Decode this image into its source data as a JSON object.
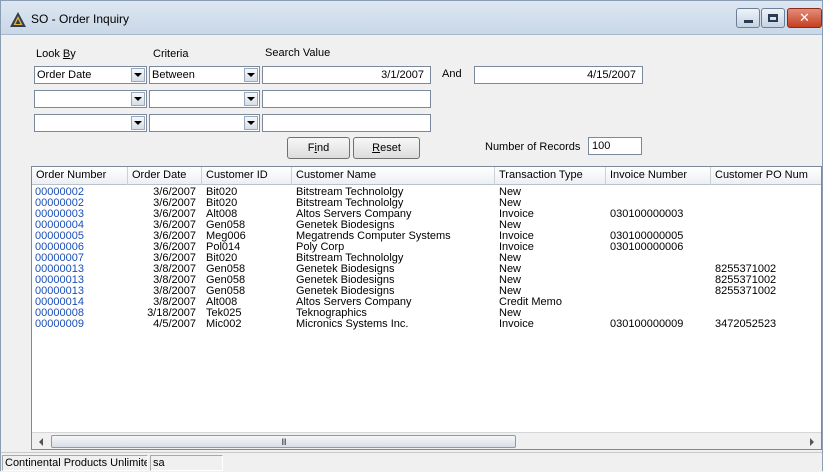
{
  "window": {
    "title": "SO - Order Inquiry"
  },
  "labels": {
    "look_by_prefix": "Look ",
    "look_by_underlined": "B",
    "look_by_suffix": "y",
    "criteria": "Criteria",
    "search_value": "Search Value",
    "and": "And",
    "number_of_records": "Number of Records"
  },
  "filters": [
    {
      "look_by": "Order Date",
      "criteria": "Between",
      "value": "3/1/2007",
      "and_value": "4/15/2007"
    },
    {
      "look_by": "",
      "criteria": "",
      "value": ""
    },
    {
      "look_by": "",
      "criteria": "",
      "value": ""
    }
  ],
  "buttons": {
    "find_underlined": "i",
    "find_prefix": "F",
    "find_suffix": "nd",
    "reset_underlined": "R",
    "reset_suffix": "eset"
  },
  "number_of_records": "100",
  "grid": {
    "columns": [
      "Order Number",
      "Order Date",
      "Customer ID",
      "Customer Name",
      "Transaction Type",
      "Invoice Number",
      "Customer PO Num"
    ],
    "rows": [
      [
        "00000002",
        "3/6/2007",
        "Bit020",
        "Bitstream Technololgy",
        "New",
        "",
        ""
      ],
      [
        "00000002",
        "3/6/2007",
        "Bit020",
        "Bitstream Technololgy",
        "New",
        "",
        ""
      ],
      [
        "00000003",
        "3/6/2007",
        "Alt008",
        "Altos Servers Company",
        "Invoice",
        "030100000003",
        ""
      ],
      [
        "00000004",
        "3/6/2007",
        "Gen058",
        "Genetek Biodesigns",
        "New",
        "",
        ""
      ],
      [
        "00000005",
        "3/6/2007",
        "Meg006",
        "Megatrends Computer Systems",
        "Invoice",
        "030100000005",
        ""
      ],
      [
        "00000006",
        "3/6/2007",
        "Pol014",
        "Poly Corp",
        "Invoice",
        "030100000006",
        ""
      ],
      [
        "00000007",
        "3/6/2007",
        "Bit020",
        "Bitstream Technololgy",
        "New",
        "",
        ""
      ],
      [
        "00000013",
        "3/8/2007",
        "Gen058",
        "Genetek Biodesigns",
        "New",
        "",
        "8255371002"
      ],
      [
        "00000013",
        "3/8/2007",
        "Gen058",
        "Genetek Biodesigns",
        "New",
        "",
        "8255371002"
      ],
      [
        "00000013",
        "3/8/2007",
        "Gen058",
        "Genetek Biodesigns",
        "New",
        "",
        "8255371002"
      ],
      [
        "00000014",
        "3/8/2007",
        "Alt008",
        "Altos Servers Company",
        "Credit Memo",
        "",
        ""
      ],
      [
        "00000008",
        "3/18/2007",
        "Tek025",
        "Teknographics",
        "New",
        "",
        ""
      ],
      [
        "00000009",
        "4/5/2007",
        "Mic002",
        "Micronics Systems Inc.",
        "Invoice",
        "030100000009",
        "3472052523"
      ]
    ]
  },
  "status": {
    "company": "Continental Products Unlimite",
    "user": "sa"
  },
  "scrollbar": {
    "thumb_grip": "III"
  },
  "colors": {
    "order_link": "#1a4fb8",
    "close_button": "#c4401f"
  }
}
